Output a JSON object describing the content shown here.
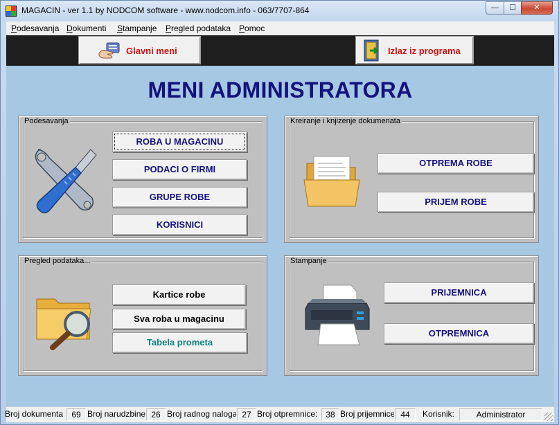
{
  "window": {
    "title": "MAGACIN - ver 1.1 by NODCOM software - www.nodcom.info - 063/7707-864",
    "controls": {
      "minimize": "—",
      "maximize": "☐",
      "close": "✕"
    }
  },
  "menubar": {
    "items": [
      {
        "label": "Podesavanja"
      },
      {
        "label": "Dokumenti"
      },
      {
        "label": "Stampanje"
      },
      {
        "label": "Pregled podataka"
      },
      {
        "label": "Pomoc"
      }
    ]
  },
  "toolbar": {
    "glavni_meni": {
      "label": "Glavni meni",
      "icon": "hand-menu-icon"
    },
    "izlaz": {
      "label": "Izlaz iz programa",
      "icon": "exit-door-icon"
    }
  },
  "main": {
    "title": "MENI ADMINISTRATORA",
    "podesavanja": {
      "legend": "Podesavanja",
      "icon": "tools-icon",
      "buttons": [
        "ROBA U MAGACINU",
        "PODACI O FIRMI",
        "GRUPE ROBE",
        "KORISNICI"
      ]
    },
    "dokumenti": {
      "legend": "Kreiranje i knjizenje dokumenata",
      "icon": "folder-document-icon",
      "buttons": [
        "OTPREMA ROBE",
        "PRIJEM ROBE"
      ]
    },
    "pregled": {
      "legend": "Pregled podataka...",
      "icon": "folder-search-icon",
      "buttons": [
        "Kartice robe",
        "Sva roba u magacinu",
        "Tabela prometa"
      ]
    },
    "stampanje": {
      "legend": "Stampanje",
      "icon": "printer-icon",
      "buttons": [
        "PRIJEMNICA",
        "OTPREMNICA"
      ]
    }
  },
  "statusbar": {
    "broj_dokumenta": {
      "label": "Broj dokumenta",
      "value": "69"
    },
    "broj_narudzbine": {
      "label": "Broj narudzbine",
      "value": "26"
    },
    "broj_radnog_naloga": {
      "label": "Broj radnog naloga",
      "value": "27"
    },
    "broj_otpremnice": {
      "label": "Broj otpremnice:",
      "value": "38"
    },
    "broj_prijemnice": {
      "label": "Broj prijemnice",
      "value": "44"
    },
    "korisnik": {
      "label": "Korisnik:",
      "value": "Administrator"
    }
  }
}
